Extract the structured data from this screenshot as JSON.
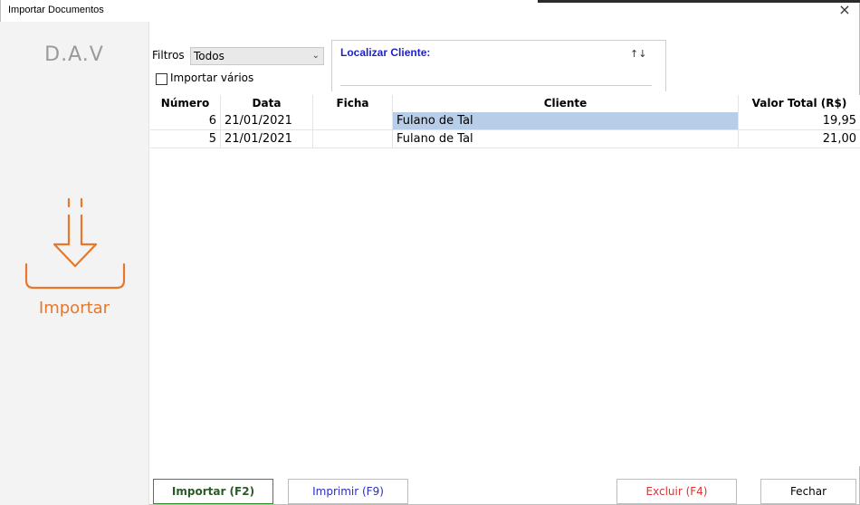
{
  "window": {
    "title": "Importar Documentos",
    "close_icon": "×"
  },
  "sidebar": {
    "logo_text": "D.A.V",
    "import_label": "Importar",
    "accent_color": "#e7772a"
  },
  "filters": {
    "label": "Filtros",
    "selected": "Todos",
    "multi_label": "Importar vários"
  },
  "search": {
    "label": "Localizar Cliente:",
    "sort_glyph": "↑↓",
    "value": ""
  },
  "table": {
    "columns": [
      "Número",
      "Data",
      "Ficha",
      "Cliente",
      "Valor Total (R$)"
    ],
    "rows": [
      {
        "numero": "6",
        "data": "21/01/2021",
        "ficha": "",
        "cliente": "Fulano de Tal",
        "valor": "19,95"
      },
      {
        "numero": "5",
        "data": "21/01/2021",
        "ficha": "",
        "cliente": "Fulano de Tal",
        "valor": "21,00"
      }
    ]
  },
  "buttons": {
    "importar": "Importar (F2)",
    "imprimir": "Imprimir (F9)",
    "excluir": "Excluir (F4)",
    "fechar": "Fechar"
  }
}
